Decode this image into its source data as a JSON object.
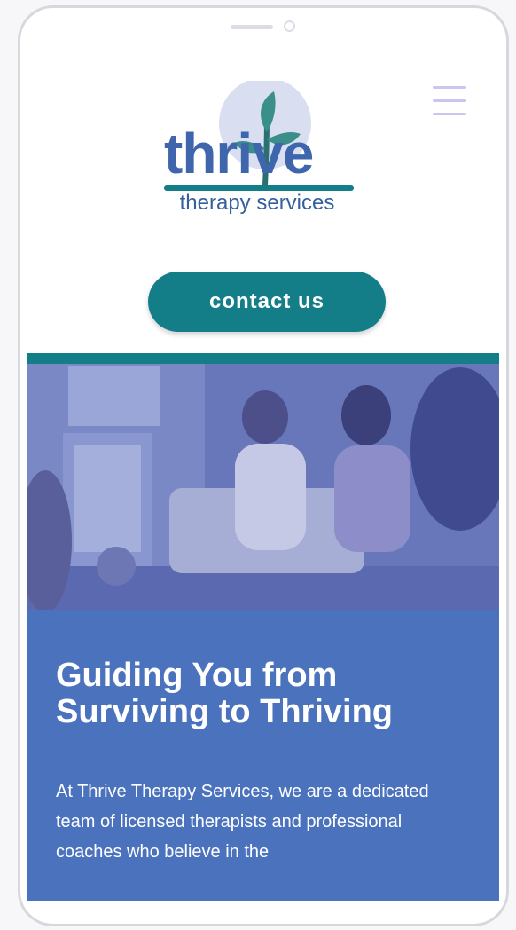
{
  "header": {
    "logo": {
      "wordmark": "thrive",
      "tagline": "therapy services"
    },
    "menu_icon": "hamburger-menu-icon"
  },
  "cta": {
    "contact_label": "contact us"
  },
  "hero": {
    "image_alt": "photo-of-smiling-women-in-group-session",
    "title": "Guiding You from Surviving to Thriving",
    "body": "At Thrive Therapy Services, we are a dedicated team of licensed therapists and professional coaches who believe in the"
  },
  "colors": {
    "brand_teal": "#147e88",
    "brand_blue": "#3f66ad",
    "hero_band": "#4b72bd",
    "menu_lines": "#c9c6f1"
  }
}
